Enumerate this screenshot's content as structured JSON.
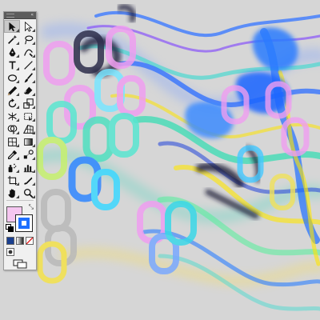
{
  "canvas": {
    "background": "#d6d6d6",
    "artwork_icon": "abstract-chain-artwork"
  },
  "tools_panel": {
    "tools": [
      {
        "name": "selection-tool",
        "icon": "arrow-icon",
        "selected": true
      },
      {
        "name": "direct-selection-tool",
        "icon": "hollow-arrow-icon"
      },
      {
        "name": "magic-wand-tool",
        "icon": "magic-wand-icon"
      },
      {
        "name": "lasso-tool",
        "icon": "lasso-icon"
      },
      {
        "name": "pen-tool",
        "icon": "pen-icon"
      },
      {
        "name": "curvature-tool",
        "icon": "curvature-pen-icon"
      },
      {
        "name": "type-tool",
        "icon": "type-icon"
      },
      {
        "name": "line-segment-tool",
        "icon": "line-icon"
      },
      {
        "name": "rectangle-tool",
        "icon": "rectangle-icon"
      },
      {
        "name": "paintbrush-tool",
        "icon": "brush-icon"
      },
      {
        "name": "pencil-tool",
        "icon": "pencil-icon"
      },
      {
        "name": "eraser-tool",
        "icon": "eraser-icon"
      },
      {
        "name": "rotate-tool",
        "icon": "rotate-icon"
      },
      {
        "name": "scale-tool",
        "icon": "scale-icon"
      },
      {
        "name": "width-tool",
        "icon": "width-icon"
      },
      {
        "name": "free-transform-tool",
        "icon": "free-transform-icon"
      },
      {
        "name": "shape-builder-tool",
        "icon": "shape-builder-icon"
      },
      {
        "name": "perspective-grid-tool",
        "icon": "perspective-grid-icon"
      },
      {
        "name": "mesh-tool",
        "icon": "mesh-icon"
      },
      {
        "name": "gradient-tool",
        "icon": "gradient-icon"
      },
      {
        "name": "eyedropper-tool",
        "icon": "eyedropper-icon"
      },
      {
        "name": "blend-tool",
        "icon": "blend-icon"
      },
      {
        "name": "symbol-sprayer-tool",
        "icon": "symbol-sprayer-icon"
      },
      {
        "name": "column-graph-tool",
        "icon": "column-graph-icon"
      },
      {
        "name": "artboard-tool",
        "icon": "artboard-icon"
      },
      {
        "name": "slice-tool",
        "icon": "slice-icon"
      },
      {
        "name": "hand-tool",
        "icon": "hand-icon"
      },
      {
        "name": "zoom-tool",
        "icon": "zoom-icon"
      }
    ],
    "fill_color": "#f5c6f0",
    "stroke_color": "#1f6fff",
    "color_modes": [
      "color",
      "gradient",
      "none"
    ],
    "draw_modes": [
      "draw-normal",
      "draw-behind",
      "draw-inside"
    ],
    "screen_mode_icon": "screen-mode-icon"
  }
}
